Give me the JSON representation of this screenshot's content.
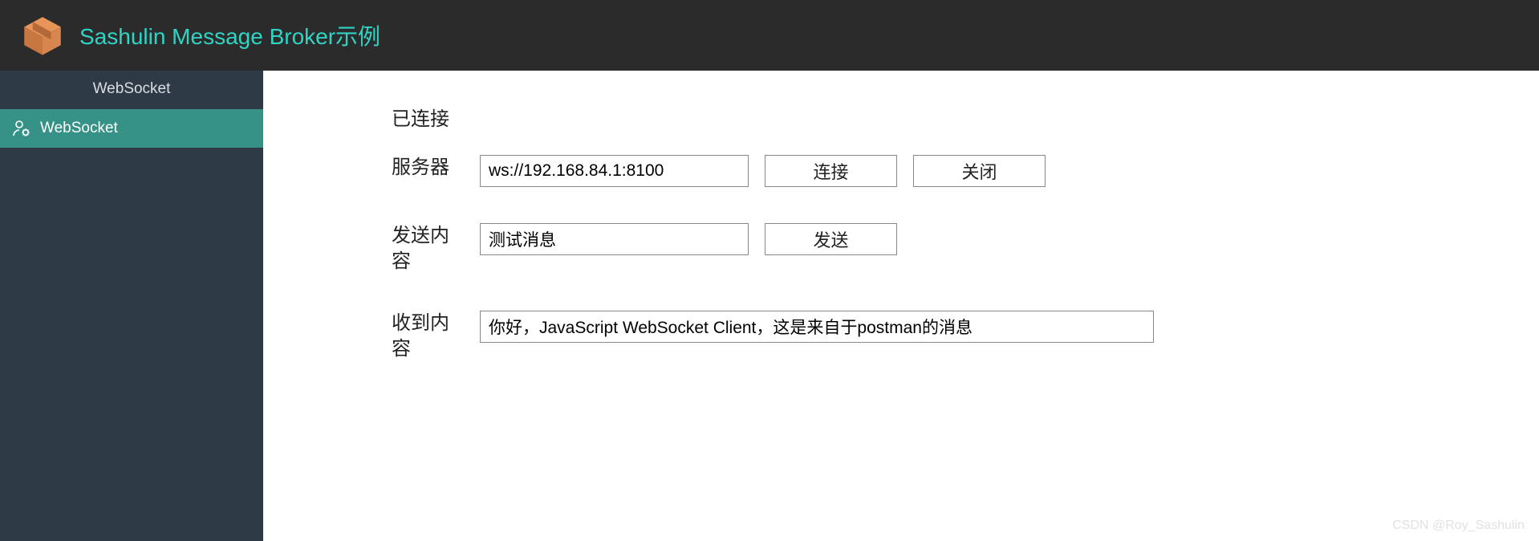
{
  "header": {
    "title": "Sashulin Message Broker示例"
  },
  "sidebar": {
    "section_label": "WebSocket",
    "items": [
      {
        "label": "WebSocket"
      }
    ]
  },
  "main": {
    "status": "已连接",
    "server": {
      "label": "服务器",
      "value": "ws://192.168.84.1:8100",
      "connect_btn": "连接",
      "close_btn": "关闭"
    },
    "send": {
      "label": "发送内容",
      "value": "测试消息",
      "send_btn": "发送"
    },
    "received": {
      "label": "收到内容",
      "value": "你好，JavaScript WebSocket Client，这是来自于postman的消息"
    }
  },
  "watermark": "CSDN @Roy_Sashulin"
}
